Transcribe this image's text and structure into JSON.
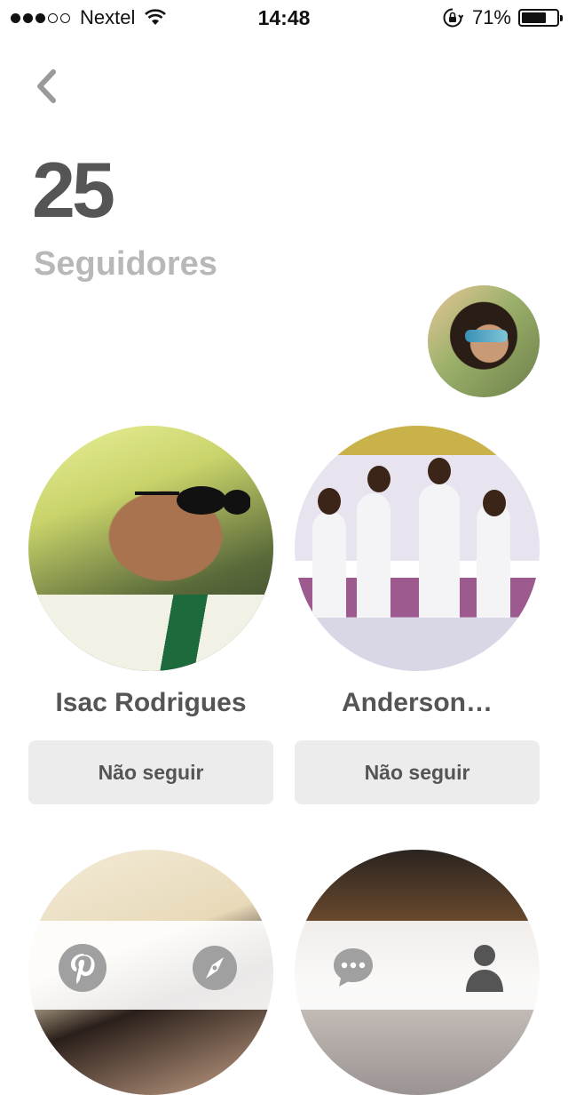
{
  "status_bar": {
    "signal_dots": 5,
    "signal_filled": 3,
    "carrier": "Nextel",
    "time": "14:48",
    "battery_text": "71%",
    "battery_level": 0.71
  },
  "header": {
    "back_icon": "chevron-left-icon",
    "follower_count": "25",
    "count_label": "Seguidores"
  },
  "followers": [
    {
      "name": "Isac Rodrigues",
      "button_label": "Não seguir"
    },
    {
      "name": "Anderson…",
      "button_label": "Não seguir"
    },
    {
      "name": "",
      "button_label": ""
    },
    {
      "name": "",
      "button_label": ""
    }
  ],
  "tab_bar": {
    "items": [
      {
        "icon": "pinterest-icon",
        "active": false
      },
      {
        "icon": "compass-icon",
        "active": false
      },
      {
        "icon": "chat-icon",
        "active": false
      },
      {
        "icon": "profile-icon",
        "active": true
      }
    ]
  },
  "colors": {
    "count_text": "#555555",
    "label_text": "#b8b8b8",
    "button_bg": "#ececec",
    "tab_inactive": "#a0a0a0",
    "tab_active": "#555555"
  }
}
